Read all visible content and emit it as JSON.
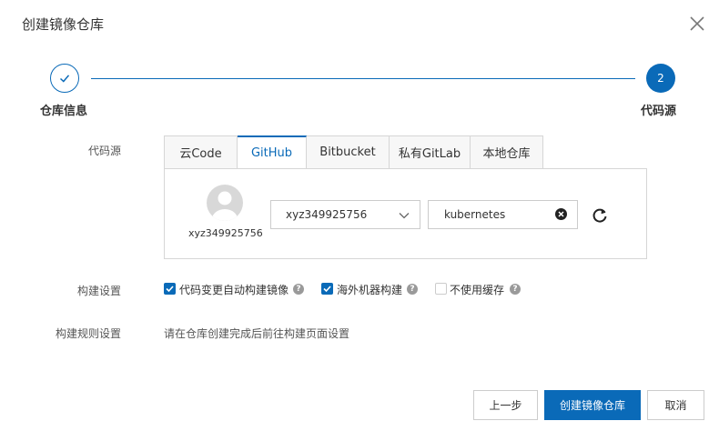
{
  "dialog": {
    "title": "创建镜像仓库"
  },
  "stepper": {
    "steps": [
      {
        "label": "仓库信息",
        "status": "done"
      },
      {
        "label": "代码源",
        "status": "active",
        "number": "2"
      }
    ]
  },
  "code_source": {
    "label": "代码源",
    "tabs": [
      "云Code",
      "GitHub",
      "Bitbucket",
      "私有GitLab",
      "本地仓库"
    ],
    "active_tab": "GitHub",
    "account_name": "xyz349925756",
    "namespace_select": "xyz349925756",
    "repo_input": "kubernetes"
  },
  "build_settings": {
    "label": "构建设置",
    "options": [
      {
        "label": "代码变更自动构建镜像",
        "checked": true
      },
      {
        "label": "海外机器构建",
        "checked": true
      },
      {
        "label": "不使用缓存",
        "checked": false
      }
    ]
  },
  "build_rules": {
    "label": "构建规则设置",
    "hint": "请在仓库创建完成后前往构建页面设置"
  },
  "footer": {
    "prev_label": "上一步",
    "create_label": "创建镜像仓库",
    "cancel_label": "取消"
  },
  "colors": {
    "accent": "#0a6ab8",
    "border": "#d6d6d6"
  }
}
